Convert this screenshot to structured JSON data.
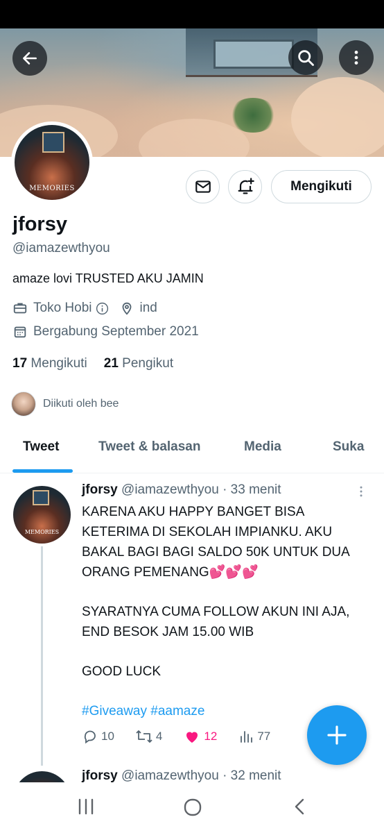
{
  "profile": {
    "display_name": "jforsy",
    "handle": "@iamazewthyou",
    "bio": "amaze lovi TRUSTED AKU JAMIN",
    "category": "Toko Hobi",
    "location": "ind",
    "joined": "Bergabung September 2021",
    "following_count": "17",
    "following_label": "Mengikuti",
    "followers_count": "21",
    "followers_label": "Pengikut",
    "followed_by": "Diikuti oleh bee",
    "avatar_caption": "MEMORIES"
  },
  "actions": {
    "follow_label": "Mengikuti"
  },
  "tabs": [
    {
      "label": "Tweet",
      "active": true
    },
    {
      "label": "Tweet & balasan",
      "active": false
    },
    {
      "label": "Media",
      "active": false
    },
    {
      "label": "Suka",
      "active": false
    }
  ],
  "tweet": {
    "name": "jforsy",
    "handle": "@iamazewthyou",
    "time": "· 33 menit",
    "paragraph1": "KARENA AKU HAPPY BANGET BISA KETERIMA DI SEKOLAH IMPIANKU. AKU BAKAL BAGI BAGI SALDO 50K UNTUK DUA ORANG PEMENANG💕💕💕",
    "paragraph2": "SYARATNYA CUMA FOLLOW AKUN INI AJA, END BESOK JAM 15.00 WIB",
    "paragraph3": "GOOD LUCK",
    "hashtags": "#Giveaway #aamaze",
    "replies": "10",
    "retweets": "4",
    "likes": "12",
    "views": "77"
  },
  "next_tweet": {
    "name": "jforsy",
    "handle": "@iamazewthyou",
    "time": "· 32 menit"
  },
  "colors": {
    "accent": "#1d9bf0",
    "like": "#f91880",
    "secondary_text": "#536471"
  }
}
